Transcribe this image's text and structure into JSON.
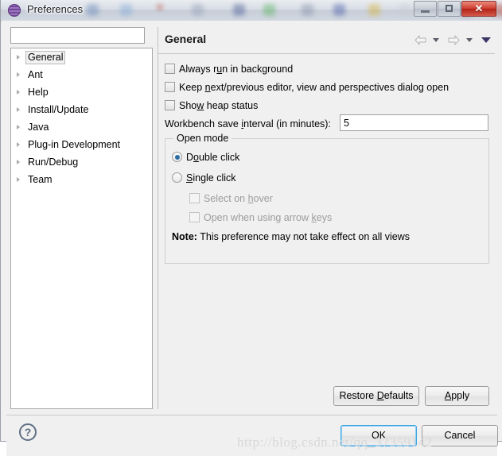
{
  "window": {
    "title": "Preferences",
    "icon": "preferences-sphere-icon",
    "caption": {
      "minimize": "",
      "maximize": "",
      "close": "✕"
    }
  },
  "sidebar": {
    "filter": {
      "value": "",
      "placeholder": ""
    },
    "items": [
      {
        "label": "General",
        "selected": true
      },
      {
        "label": "Ant",
        "selected": false
      },
      {
        "label": "Help",
        "selected": false
      },
      {
        "label": "Install/Update",
        "selected": false
      },
      {
        "label": "Java",
        "selected": false
      },
      {
        "label": "Plug-in Development",
        "selected": false
      },
      {
        "label": "Run/Debug",
        "selected": false
      },
      {
        "label": "Team",
        "selected": false
      }
    ]
  },
  "content": {
    "title": "General",
    "nav": {
      "back_icon": "arrow-left-icon",
      "back_menu_icon": "chevron-down-icon",
      "forward_icon": "arrow-right-icon",
      "forward_menu_icon": "chevron-down-icon",
      "view_menu_icon": "chevron-down-icon"
    },
    "checkboxes": [
      {
        "label_html": "Always r<u>u</u>n in background",
        "checked": false,
        "enabled": true
      },
      {
        "label_html": "Keep <u>n</u>ext/previous editor, view and perspectives dialog open",
        "checked": false,
        "enabled": true
      },
      {
        "label_html": "Sho<u>w</u> heap status",
        "checked": false,
        "enabled": true
      }
    ],
    "save_interval": {
      "label_html": "Workbench save <u>i</u>nterval (in minutes):",
      "value": "5"
    },
    "open_mode": {
      "legend": "Open mode",
      "radios": [
        {
          "label_html": "D<u>o</u>uble click",
          "checked": true
        },
        {
          "label_html": "<u>S</u>ingle click",
          "checked": false
        }
      ],
      "sub_checkboxes": [
        {
          "label_html": "Select on <u>h</u>over",
          "checked": false,
          "enabled": false
        },
        {
          "label_html": "Open when using arrow <u>k</u>eys",
          "checked": false,
          "enabled": false
        }
      ],
      "note_label": "Note:",
      "note_text": "This preference may not take effect on all views"
    },
    "buttons": {
      "restore_defaults_html": "Restore <u>D</u>efaults",
      "apply_html": "<u>A</u>pply"
    }
  },
  "footer": {
    "help_icon": "question-mark-icon",
    "ok_label": "OK",
    "cancel_label": "Cancel"
  },
  "watermark": "http://blog.csdn.net/qq_37359142",
  "colors": {
    "dialog_bg": "#f0f0f0",
    "close_red": "#cf3f30",
    "radio_blue": "#2b6ca3",
    "focus_blue": "#3fa3e0",
    "menu_caret": "#3b3668"
  }
}
